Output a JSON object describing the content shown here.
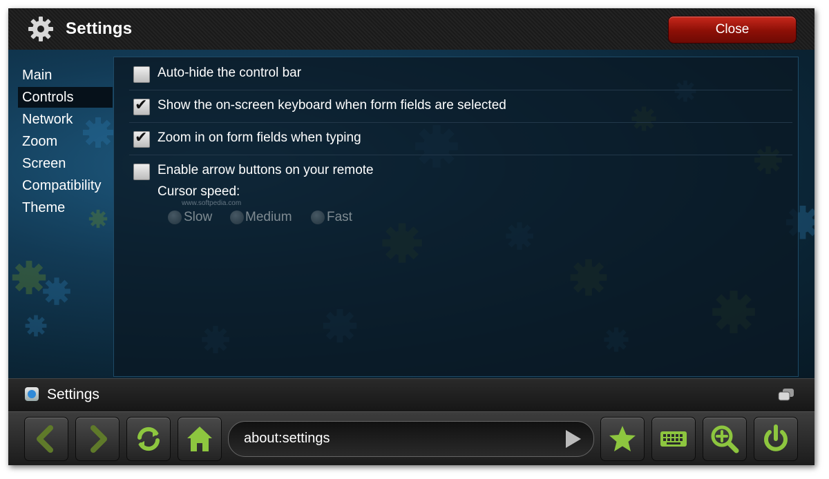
{
  "colors": {
    "accent_green": "#8dc63f",
    "close_red": "#a0160b",
    "panel_bg": "#0a1824"
  },
  "window": {
    "title": "Settings",
    "title_icon": "gear-icon",
    "close_label": "Close"
  },
  "sidebar": {
    "items": [
      {
        "label": "Main",
        "active": false
      },
      {
        "label": "Controls",
        "active": true
      },
      {
        "label": "Network",
        "active": false
      },
      {
        "label": "Zoom",
        "active": false
      },
      {
        "label": "Screen",
        "active": false
      },
      {
        "label": "Compatibility",
        "active": false
      },
      {
        "label": "Theme",
        "active": false
      }
    ]
  },
  "options": [
    {
      "label": "Auto-hide the control bar",
      "checked": false
    },
    {
      "label": "Show the on-screen keyboard when form fields are selected",
      "checked": true
    },
    {
      "label": "Zoom in on form fields when typing",
      "checked": true
    },
    {
      "label": "Enable arrow buttons on your remote",
      "checked": false
    }
  ],
  "cursor_speed": {
    "label": "Cursor speed:",
    "options": [
      "Slow",
      "Medium",
      "Fast"
    ],
    "enabled": false
  },
  "watermark": "www.softpedia.com",
  "status": {
    "text": "Settings",
    "icon": "page-icon"
  },
  "toolbar": {
    "url": "about:settings",
    "buttons": [
      "back-icon",
      "forward-icon",
      "reload-icon",
      "home-icon",
      "star-icon",
      "keyboard-icon",
      "zoom-in-icon",
      "power-icon"
    ]
  }
}
